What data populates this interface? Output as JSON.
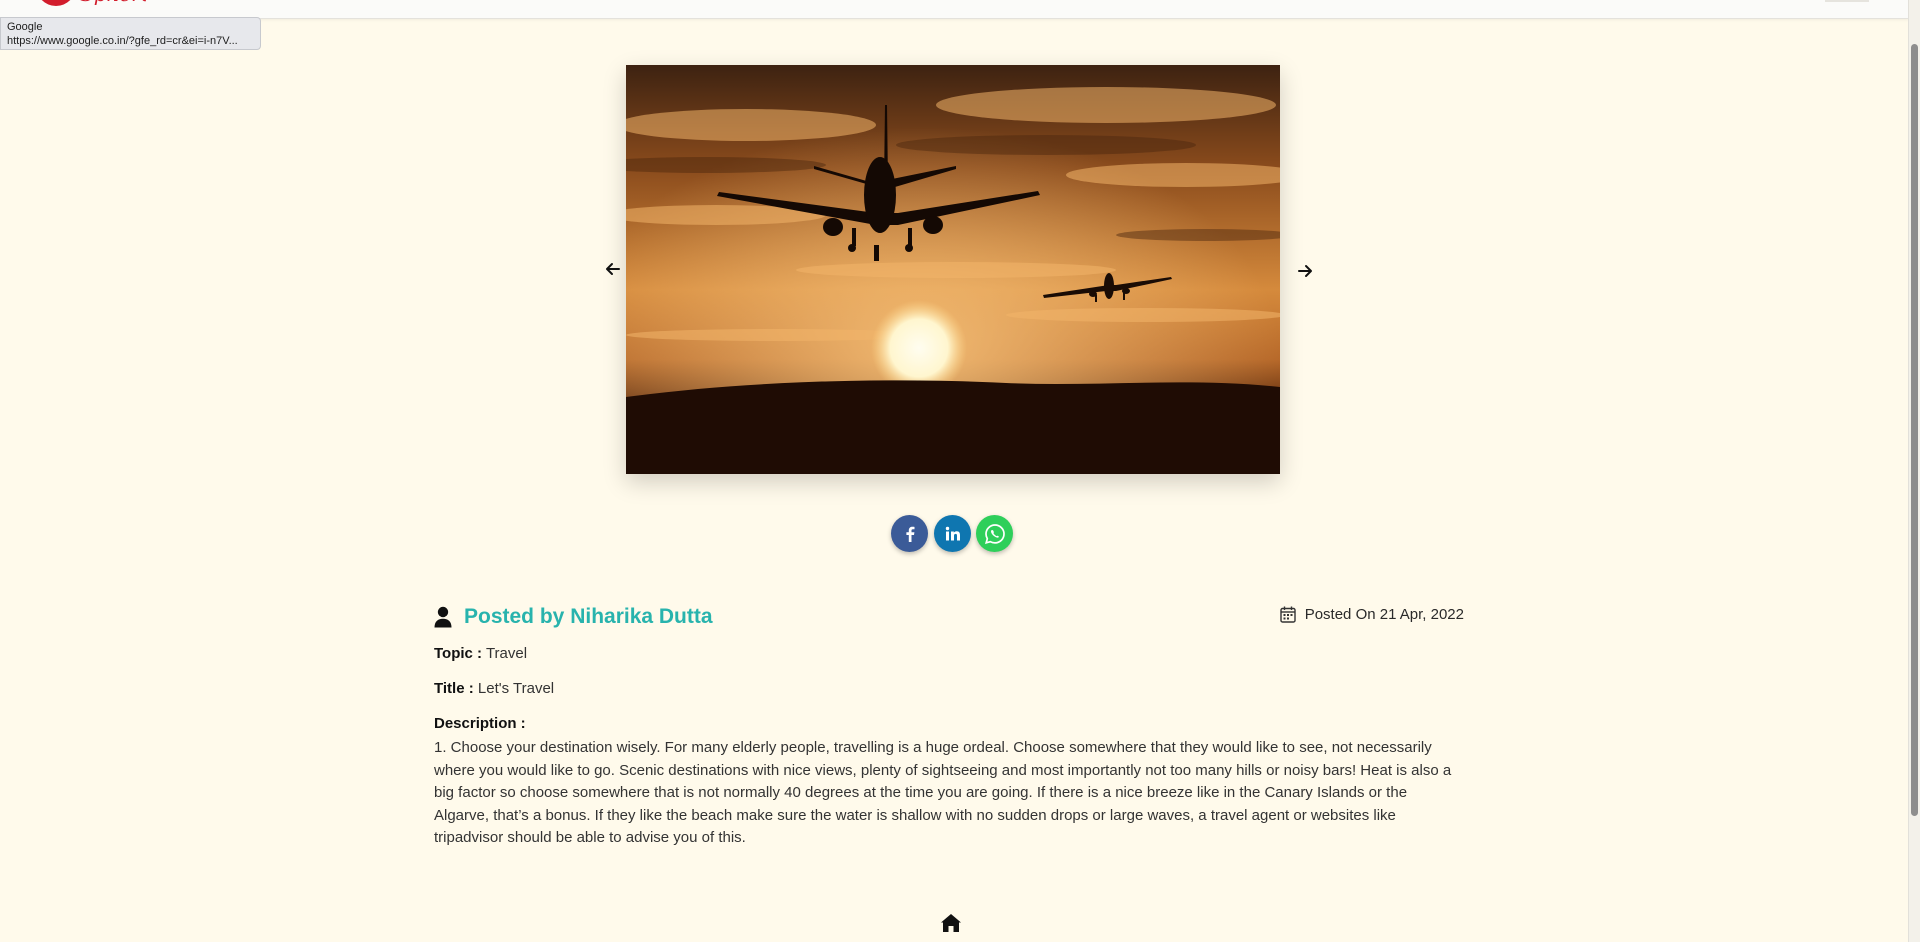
{
  "brand": {
    "logo_text": "Sphere",
    "brand_color": "#d21d2c"
  },
  "tooltip": {
    "title": "Google",
    "url": "https://www.google.co.in/?gfe_rd=cr&ei=i-n7V..."
  },
  "carousel": {
    "image_description": "airplanes-silhouette-sunset",
    "prev_icon": "arrow-left-icon",
    "next_icon": "arrow-right-icon"
  },
  "share": {
    "facebook": {
      "icon": "facebook-icon",
      "color": "#3b5b98"
    },
    "linkedin": {
      "icon": "linkedin-icon",
      "color": "#0f76b0"
    },
    "whatsapp": {
      "icon": "whatsapp-icon",
      "color": "#2ecf5a"
    }
  },
  "post": {
    "author": "Posted by Niharika Dutta",
    "author_color": "#28b3ad",
    "posted_on": "Posted On 21 Apr, 2022",
    "topic_label": "Topic :",
    "topic": "Travel",
    "title_label": "Title :",
    "title": "Let's Travel",
    "description_label": "Description :",
    "description": "1. Choose your destination wisely. For many elderly people, travelling is a huge ordeal. Choose somewhere that they would like to see, not necessarily where you would like to go. Scenic destinations with nice views, plenty of sightseeing and most importantly not too many hills or noisy bars! Heat is also a big factor so choose somewhere that is not normally 40 degrees at the time you are going. If there is a nice breeze like in the Canary Islands or the Algarve, that’s a bonus. If they like the beach make sure the water is shallow with no sudden drops or large waves, a travel agent or websites like tripadvisor should be able to advise you of this."
  },
  "footer": {
    "home_icon": "home-icon"
  },
  "colors": {
    "page_background": "#fffaeb"
  }
}
